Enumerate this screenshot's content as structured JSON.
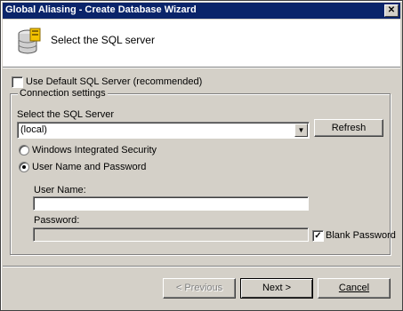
{
  "window": {
    "title": "Global Aliasing - Create Database Wizard",
    "close_glyph": "✕"
  },
  "header": {
    "title": "Select the SQL server",
    "icon": "database-wizard-icon"
  },
  "options": {
    "use_default_label": "Use Default SQL Server (recommended)",
    "use_default_checked": false
  },
  "connection": {
    "group_label": "Connection settings",
    "server_label": "Select the SQL Server",
    "server_value": "(local)",
    "refresh_label": "Refresh",
    "auth_windows_label": "Windows Integrated Security",
    "auth_sql_label": "User Name and Password",
    "auth_selected": "User Name and Password",
    "username_label": "User Name:",
    "username_value": "",
    "password_label": "Password:",
    "password_value": "",
    "blank_password_label": "Blank Password",
    "blank_password_checked": true
  },
  "footer": {
    "previous_label": "< Previous",
    "next_label": "Next >",
    "cancel_label": "Cancel"
  }
}
